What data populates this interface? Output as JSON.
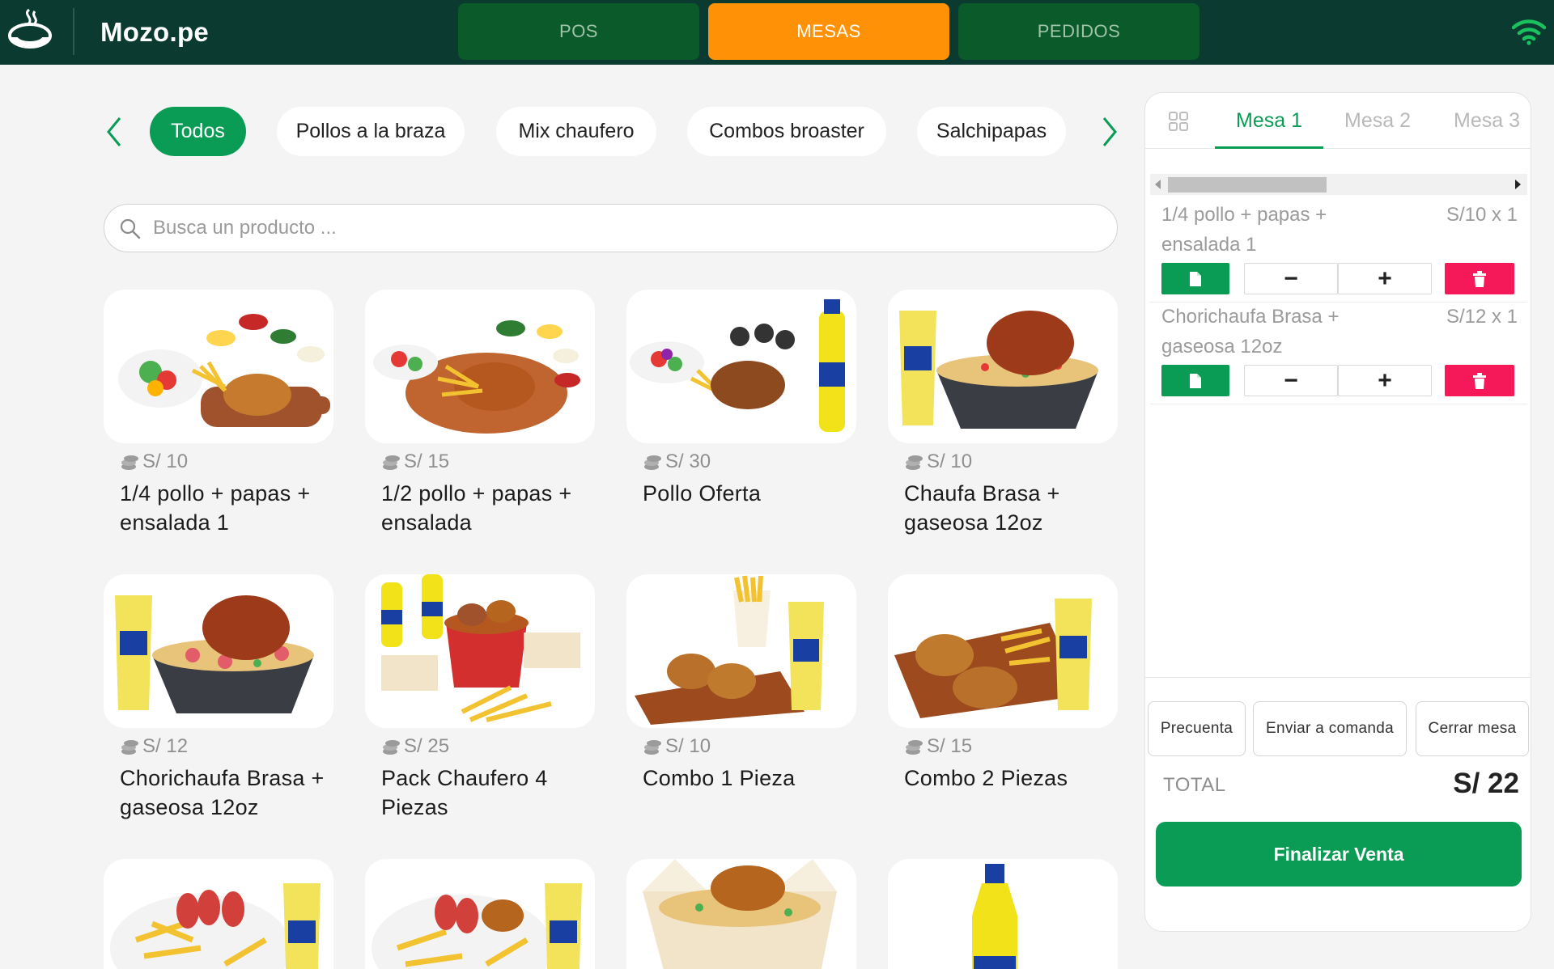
{
  "app": {
    "brand": "Mozo.pe",
    "nav_tabs": [
      {
        "label": "POS",
        "active": false
      },
      {
        "label": "MESAS",
        "active": true
      },
      {
        "label": "PEDIDOS",
        "active": false
      }
    ],
    "status_icon": "wifi-icon"
  },
  "colors": {
    "topbar": "#0b3b30",
    "accent_orange": "#ff9106",
    "primary_green": "#0a9c55",
    "delete_pink": "#f5195a"
  },
  "categories": {
    "items": [
      {
        "label": "Todos",
        "active": true
      },
      {
        "label": "Pollos a la braza",
        "active": false
      },
      {
        "label": "Mix chaufero",
        "active": false
      },
      {
        "label": "Combos broaster",
        "active": false
      },
      {
        "label": "Salchipapas",
        "active": false
      }
    ]
  },
  "search": {
    "placeholder": "Busca un producto ...",
    "value": ""
  },
  "products": [
    {
      "price": "S/ 10",
      "name": "1/4 pollo + papas + ensalada 1"
    },
    {
      "price": "S/ 15",
      "name": "1/2 pollo + papas + ensalada"
    },
    {
      "price": "S/ 30",
      "name": "Pollo Oferta"
    },
    {
      "price": "S/ 10",
      "name": "Chaufa Brasa + gaseosa 12oz"
    },
    {
      "price": "S/ 12",
      "name": "Chorichaufa Brasa + gaseosa 12oz"
    },
    {
      "price": "S/ 25",
      "name": "Pack Chaufero 4 Piezas"
    },
    {
      "price": "S/ 10",
      "name": "Combo 1 Pieza"
    },
    {
      "price": "S/ 15",
      "name": "Combo 2 Piezas"
    }
  ],
  "order_panel": {
    "tables": [
      {
        "label": "Mesa 1",
        "active": true
      },
      {
        "label": "Mesa 2",
        "active": false
      },
      {
        "label": "Mesa 3",
        "active": false
      }
    ],
    "items": [
      {
        "name": "1/4 pollo + papas + ensalada 1",
        "price": "S/10 x 1",
        "minus": "−",
        "plus": "+"
      },
      {
        "name": "Chorichaufa Brasa + gaseosa 12oz",
        "price": "S/12 x 1",
        "minus": "−",
        "plus": "+"
      }
    ],
    "actions": {
      "precuenta": "Precuenta",
      "enviar": "Enviar a comanda",
      "cerrar": "Cerrar mesa"
    },
    "total_label": "TOTAL",
    "total_value": "S/ 22",
    "finalize_label": "Finalizar Venta"
  }
}
